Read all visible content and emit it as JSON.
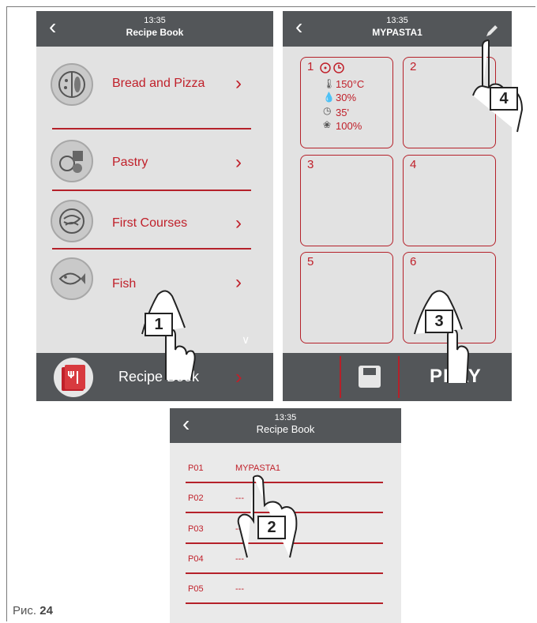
{
  "screen_a": {
    "time": "13:35",
    "title": "Recipe Book",
    "categories": [
      {
        "label": "Bread and Pizza",
        "icon": "bread-pizza-icon"
      },
      {
        "label": "Pastry",
        "icon": "pastry-icon"
      },
      {
        "label": "First Courses",
        "icon": "pasta-bowl-icon"
      },
      {
        "label": "Fish",
        "icon": "fish-icon"
      }
    ],
    "footer_label": "Recipe Book"
  },
  "screen_b": {
    "time": "13:35",
    "title": "MYPASTA1",
    "cells": [
      "1",
      "2",
      "3",
      "4",
      "5",
      "6"
    ],
    "phase1": {
      "temperature": "150°C",
      "humidity": "30%",
      "time": "35'",
      "fan": "100%"
    },
    "play_label": "PLAY"
  },
  "screen_c": {
    "time": "13:35",
    "title": "Recipe Book",
    "programs": [
      {
        "code": "P01",
        "name": "MYPASTA1"
      },
      {
        "code": "P02",
        "name": "---"
      },
      {
        "code": "P03",
        "name": "---"
      },
      {
        "code": "P04",
        "name": "---"
      },
      {
        "code": "P05",
        "name": "---"
      }
    ]
  },
  "steps": [
    "1",
    "2",
    "3",
    "4"
  ],
  "caption": {
    "prefix": "Рис.",
    "number": "24"
  },
  "colors": {
    "accent": "#c0202a",
    "header": "#535659",
    "screen_bg": "#e2e2e2"
  }
}
